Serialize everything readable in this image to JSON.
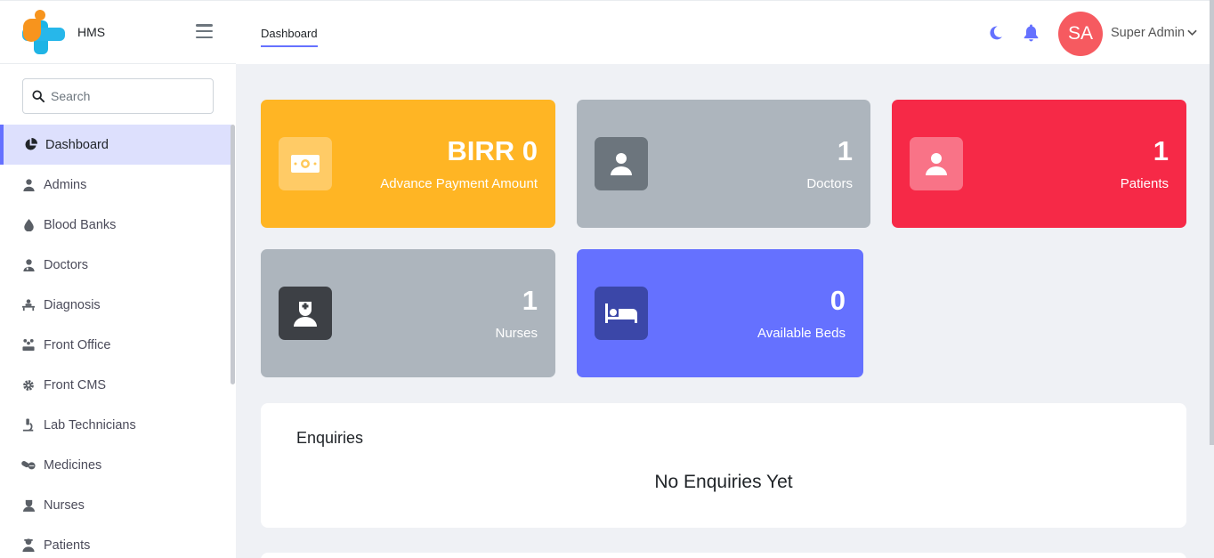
{
  "brand": {
    "name": "HMS"
  },
  "search": {
    "placeholder": "Search"
  },
  "sidebar": {
    "items": [
      {
        "label": "Dashboard",
        "icon": "pie-chart-icon",
        "active": true
      },
      {
        "label": "Admins",
        "icon": "user-icon"
      },
      {
        "label": "Blood Banks",
        "icon": "blood-drop-icon"
      },
      {
        "label": "Doctors",
        "icon": "doctor-icon"
      },
      {
        "label": "Diagnosis",
        "icon": "diagnosis-icon"
      },
      {
        "label": "Front Office",
        "icon": "front-office-icon"
      },
      {
        "label": "Front CMS",
        "icon": "gear-icon"
      },
      {
        "label": "Lab Technicians",
        "icon": "microscope-icon"
      },
      {
        "label": "Medicines",
        "icon": "pills-icon"
      },
      {
        "label": "Nurses",
        "icon": "nurse-icon"
      },
      {
        "label": "Patients",
        "icon": "patient-icon"
      }
    ]
  },
  "header": {
    "tab": "Dashboard",
    "avatar_initials": "SA",
    "user_name": "Super Admin"
  },
  "cards": {
    "advance_payment": {
      "value": "BIRR 0",
      "label": "Advance Payment Amount",
      "color": "#ffb524"
    },
    "doctors": {
      "value": "1",
      "label": "Doctors",
      "color": "#adb5bd"
    },
    "patients": {
      "value": "1",
      "label": "Patients",
      "color": "#f62947"
    },
    "nurses": {
      "value": "1",
      "label": "Nurses",
      "color": "#adb5bd"
    },
    "beds": {
      "value": "0",
      "label": "Available Beds",
      "color": "#6571ff"
    }
  },
  "enquiries": {
    "title": "Enquiries",
    "empty_text": "No Enquiries Yet"
  },
  "colors": {
    "accent": "#6571ff",
    "avatar": "#f65a60"
  }
}
